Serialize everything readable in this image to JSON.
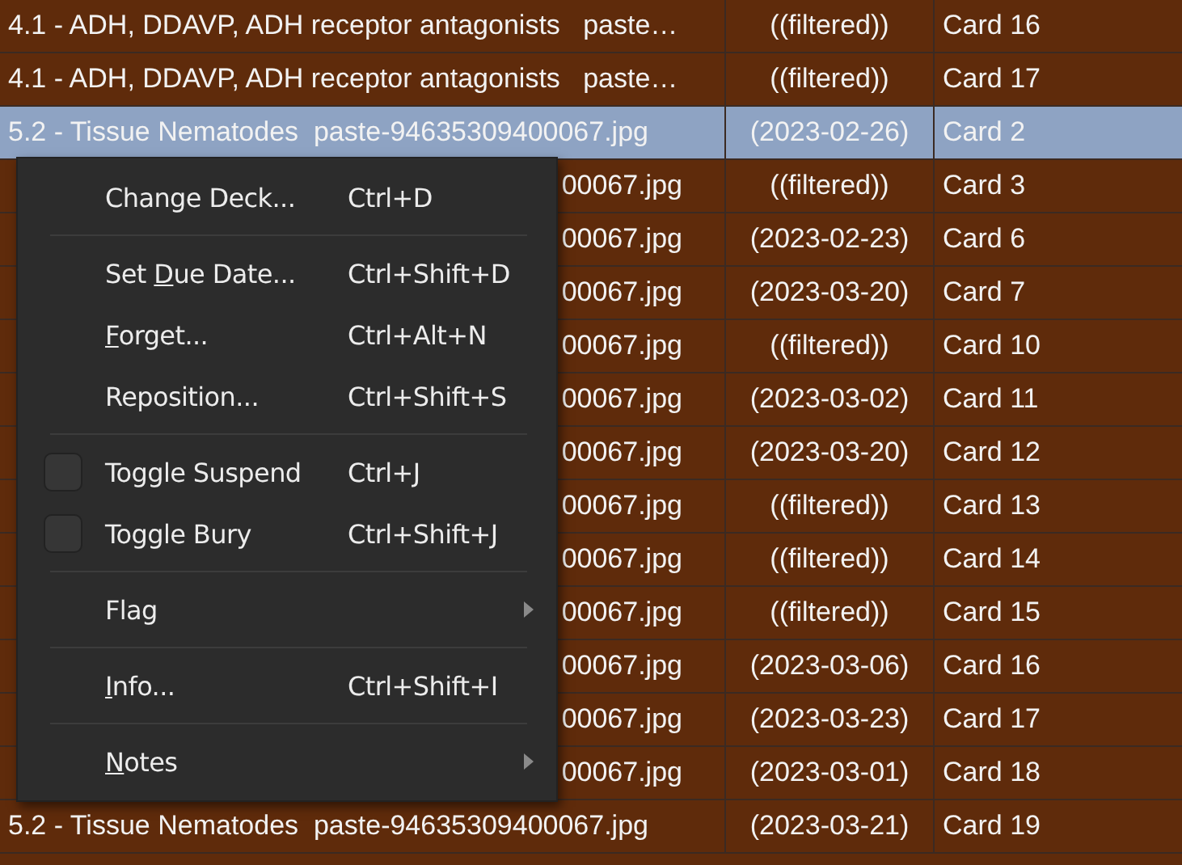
{
  "table": {
    "rows": [
      {
        "selected": false,
        "deck": {
          "text": "4.1 - ADH, DDAVP, ADH receptor antagonists   paste…"
        },
        "due": "((filtered))",
        "card": "Card 16"
      },
      {
        "selected": false,
        "deck": {
          "text": "4.1 - ADH, DDAVP, ADH receptor antagonists   paste…"
        },
        "due": "((filtered))",
        "card": "Card 17"
      },
      {
        "selected": true,
        "deck": {
          "text": "5.2 - Tissue Nematodes  paste-94635309400067.jpg"
        },
        "due": "(2023-02-26)",
        "card": "Card 2"
      },
      {
        "selected": false,
        "deck": {
          "end": "00067.jpg"
        },
        "due": "((filtered))",
        "card": "Card 3"
      },
      {
        "selected": false,
        "deck": {
          "end": "00067.jpg"
        },
        "due": "(2023-02-23)",
        "card": "Card 6"
      },
      {
        "selected": false,
        "deck": {
          "end": "00067.jpg"
        },
        "due": "(2023-03-20)",
        "card": "Card 7"
      },
      {
        "selected": false,
        "deck": {
          "end": "00067.jpg"
        },
        "due": "((filtered))",
        "card": "Card 10"
      },
      {
        "selected": false,
        "deck": {
          "end": "00067.jpg"
        },
        "due": "(2023-03-02)",
        "card": "Card 11"
      },
      {
        "selected": false,
        "deck": {
          "end": "00067.jpg"
        },
        "due": "(2023-03-20)",
        "card": "Card 12"
      },
      {
        "selected": false,
        "deck": {
          "end": "00067.jpg"
        },
        "due": "((filtered))",
        "card": "Card 13"
      },
      {
        "selected": false,
        "deck": {
          "end": "00067.jpg"
        },
        "due": "((filtered))",
        "card": "Card 14"
      },
      {
        "selected": false,
        "deck": {
          "end": "00067.jpg"
        },
        "due": "((filtered))",
        "card": "Card 15"
      },
      {
        "selected": false,
        "deck": {
          "end": "00067.jpg"
        },
        "due": "(2023-03-06)",
        "card": "Card 16"
      },
      {
        "selected": false,
        "deck": {
          "end": "00067.jpg"
        },
        "due": "(2023-03-23)",
        "card": "Card 17"
      },
      {
        "selected": false,
        "deck": {
          "end": "00067.jpg"
        },
        "due": "(2023-03-01)",
        "card": "Card 18"
      },
      {
        "selected": false,
        "deck": {
          "text": "5.2 - Tissue Nematodes  paste-94635309400067.jpg"
        },
        "due": "(2023-03-21)",
        "card": "Card 19"
      }
    ]
  },
  "context_menu": {
    "items": [
      {
        "kind": "item",
        "label": "Change Deck...",
        "shortcut": "Ctrl+D"
      },
      {
        "kind": "separator"
      },
      {
        "kind": "item",
        "label_parts": [
          {
            "text": "Set ",
            "underlined": false
          },
          {
            "text": "D",
            "underlined": true
          },
          {
            "text": "ue Date...",
            "underlined": false
          }
        ],
        "shortcut": "Ctrl+Shift+D"
      },
      {
        "kind": "item",
        "label_parts": [
          {
            "text": "F",
            "underlined": true
          },
          {
            "text": "orget...",
            "underlined": false
          }
        ],
        "shortcut": "Ctrl+Alt+N"
      },
      {
        "kind": "item",
        "label": "Reposition...",
        "shortcut": "Ctrl+Shift+S"
      },
      {
        "kind": "separator"
      },
      {
        "kind": "check",
        "label": "Toggle Suspend",
        "shortcut": "Ctrl+J",
        "checked": false
      },
      {
        "kind": "check",
        "label": "Toggle Bury",
        "shortcut": "Ctrl+Shift+J",
        "checked": false
      },
      {
        "kind": "separator"
      },
      {
        "kind": "submenu",
        "label": "Flag"
      },
      {
        "kind": "separator"
      },
      {
        "kind": "item",
        "label_parts": [
          {
            "text": "I",
            "underlined": true
          },
          {
            "text": "nfo...",
            "underlined": false
          }
        ],
        "shortcut": "Ctrl+Shift+I"
      },
      {
        "kind": "separator"
      },
      {
        "kind": "submenu",
        "label_parts": [
          {
            "text": "N",
            "underlined": true
          },
          {
            "text": "otes",
            "underlined": false
          }
        ]
      }
    ]
  }
}
